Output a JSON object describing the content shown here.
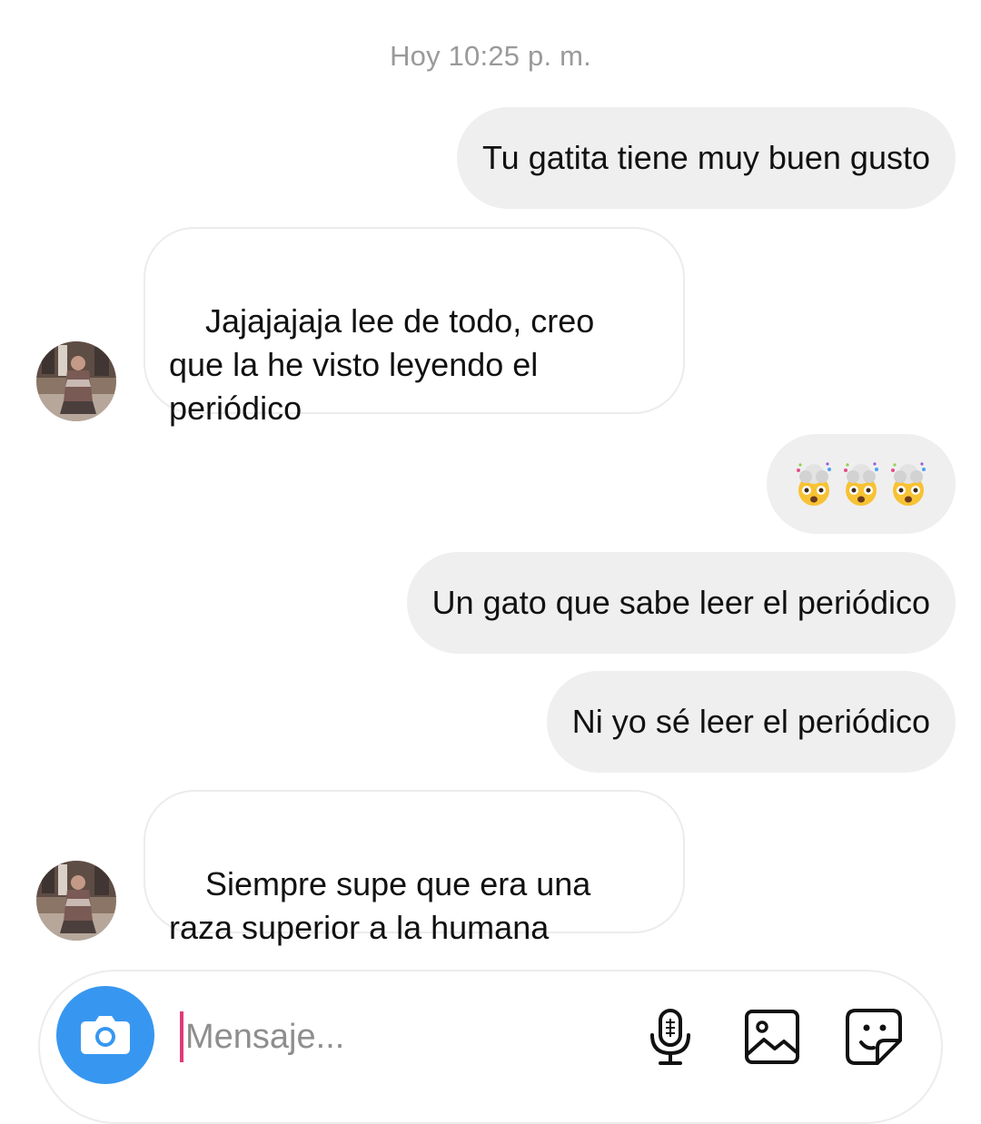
{
  "chat": {
    "timestamp": "Hoy 10:25 p. m.",
    "messages": [
      {
        "direction": "outgoing",
        "text": "Tu gatita tiene muy buen gusto"
      },
      {
        "direction": "incoming",
        "text": "Jajajajaja lee de todo, creo\nque la he visto leyendo el\nperiódico"
      },
      {
        "direction": "outgoing",
        "text": "🤯🤯🤯",
        "emoji_name": "exploding-head-emoji",
        "emoji_count": 3
      },
      {
        "direction": "outgoing",
        "text": "Un gato que sabe leer el periódico"
      },
      {
        "direction": "outgoing",
        "text": "Ni yo sé leer el periódico"
      },
      {
        "direction": "incoming",
        "text": "Siempre supe que era una\nraza superior a la humana"
      }
    ]
  },
  "composer": {
    "placeholder": "Mensaje...",
    "value": "",
    "icons": [
      "camera-icon",
      "microphone-icon",
      "image-icon",
      "sticker-icon"
    ]
  },
  "colors": {
    "accent": "#3797f0",
    "outgoing_bubble": "#efefef",
    "incoming_border": "#ececec",
    "caret": "#e23a7a",
    "timestamp": "#9a9a9a"
  }
}
